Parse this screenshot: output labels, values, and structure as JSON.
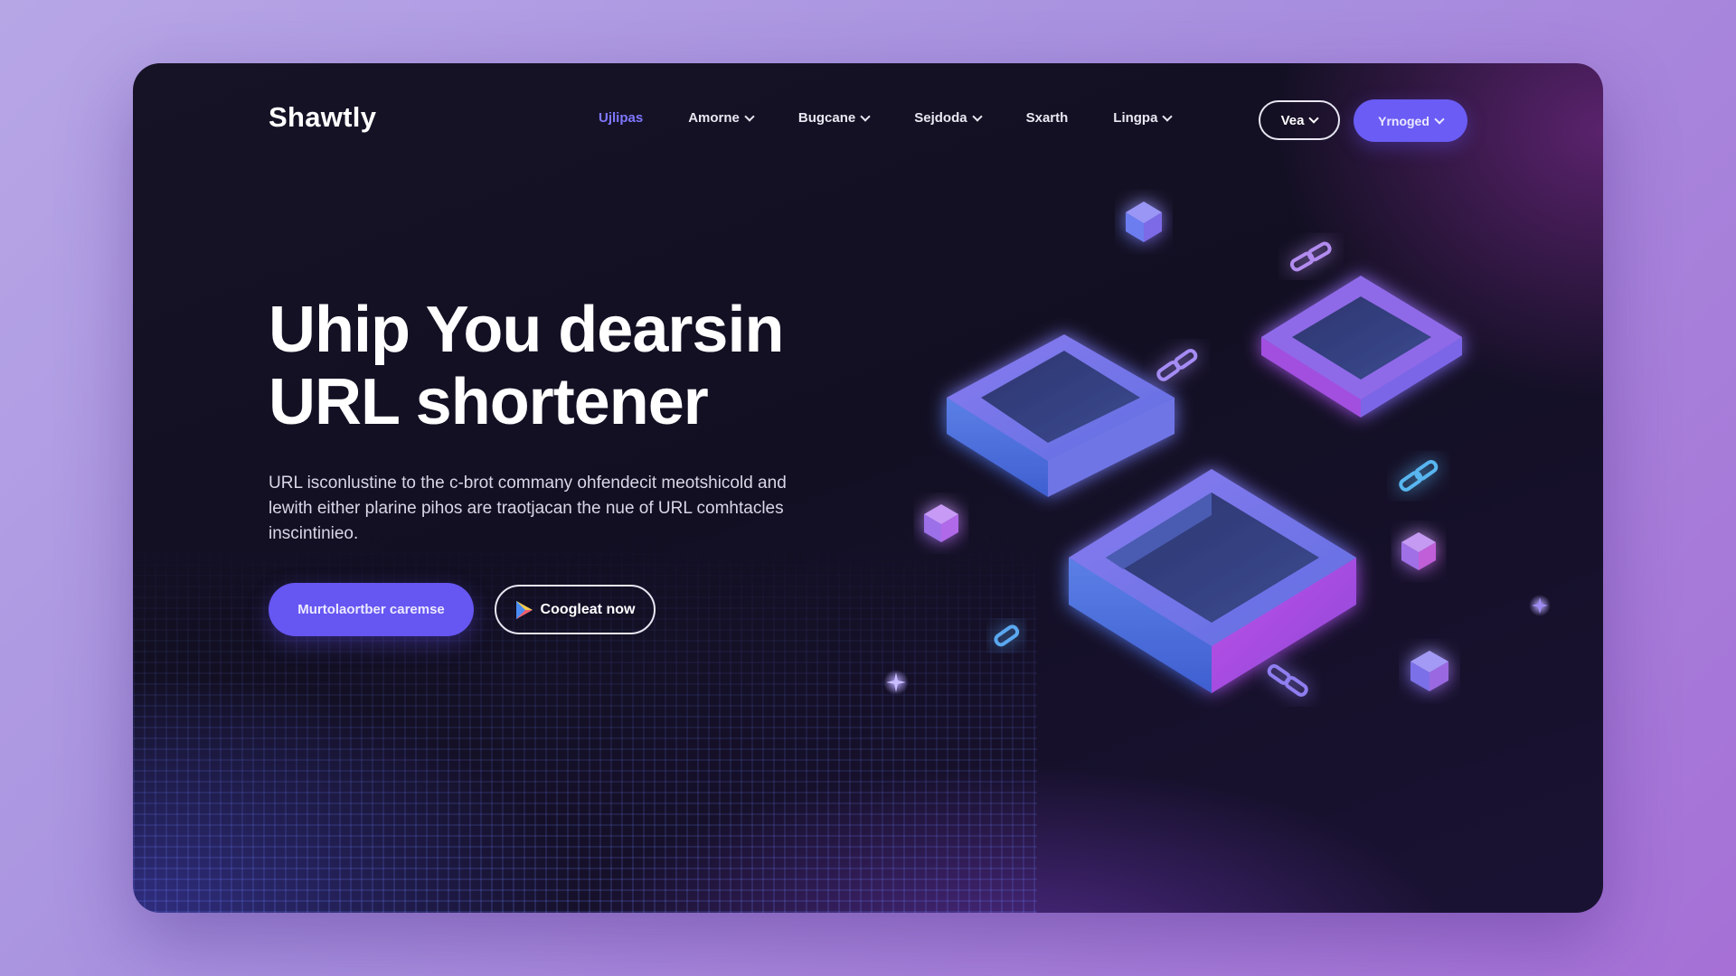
{
  "brand": {
    "name": "Shawtly"
  },
  "nav": {
    "items": [
      {
        "label": "Ujlipas",
        "dropdown": false,
        "active": true
      },
      {
        "label": "Amorne",
        "dropdown": true,
        "active": false
      },
      {
        "label": "Bugcane",
        "dropdown": true,
        "active": false
      },
      {
        "label": "Sejdoda",
        "dropdown": true,
        "active": false
      },
      {
        "label": "Sxarth",
        "dropdown": false,
        "active": false
      },
      {
        "label": "Lingpa",
        "dropdown": true,
        "active": false
      }
    ]
  },
  "header_actions": {
    "outline_label": "Vea",
    "primary_label": "Yrnoged"
  },
  "hero": {
    "title_line1": "Uhip You dearsin",
    "title_line2": "URL shortener",
    "description": "URL isconlustine to the c-brot commany ohfendecit meotshicold and lewith either plarine pihos are traotjacan the nue of URL comhtacles inscintinieo.",
    "cta_primary": "Murtolaortber caremse",
    "cta_secondary": "Coogleat now"
  },
  "colors": {
    "accent": "#6a5cf4",
    "active_nav": "#7f78ff",
    "card_bg": "#141024",
    "page_bg": "#a993e0"
  },
  "icons": {
    "play": "play-store-icon",
    "chevron": "chevron-down-icon",
    "link": "link-icon",
    "cube": "cube-icon"
  }
}
